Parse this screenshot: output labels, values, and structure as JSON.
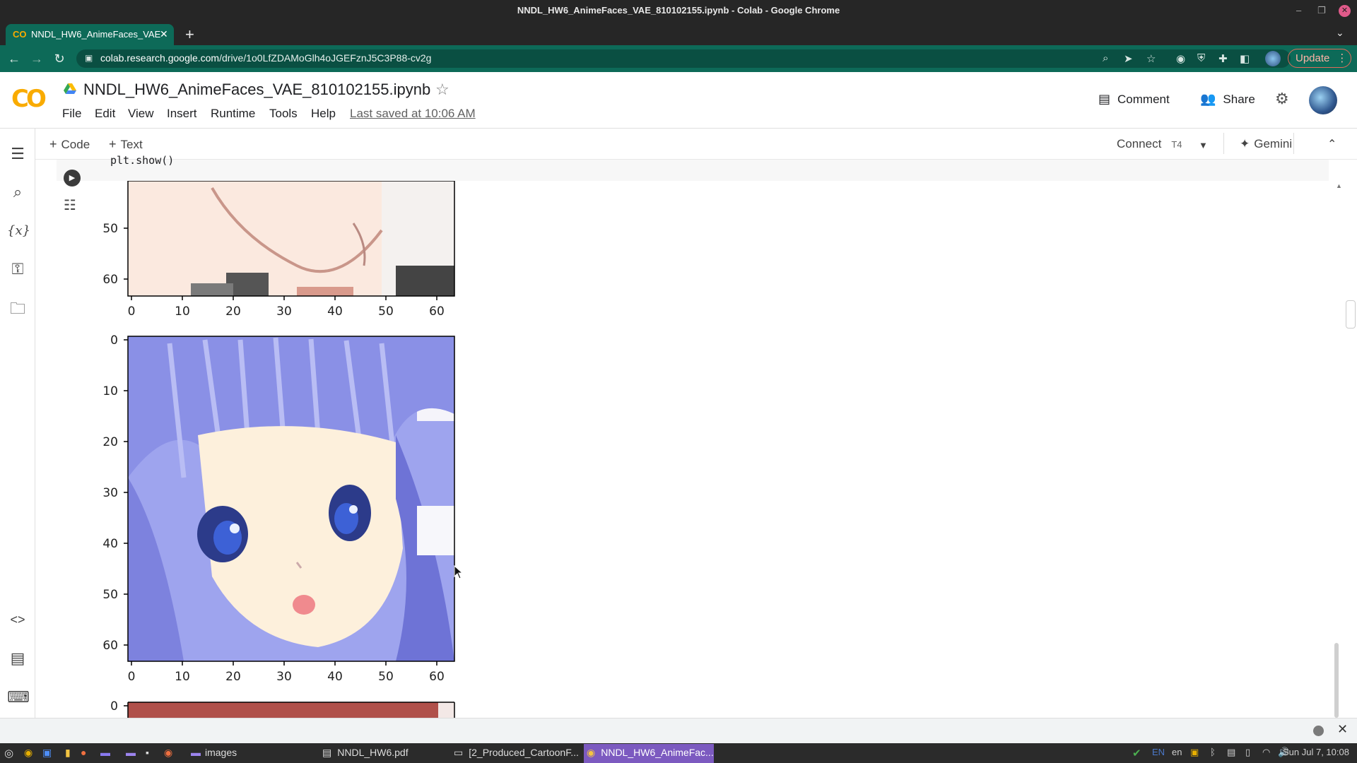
{
  "window": {
    "title": "NNDL_HW6_AnimeFaces_VAE_810102155.ipynb - Colab - Google Chrome"
  },
  "browser": {
    "tab_title": "NNDL_HW6_AnimeFaces_VAE",
    "url_host": "colab.research.google.com",
    "url_path": "/drive/1o0LfZDAMoGlh4oJGEFznJ5C3P88-cv2g",
    "update_label": "Update"
  },
  "notebook": {
    "title": "NNDL_HW6_AnimeFaces_VAE_810102155.ipynb",
    "menu": [
      "File",
      "Edit",
      "View",
      "Insert",
      "Runtime",
      "Tools",
      "Help"
    ],
    "last_saved": "Last saved at 10:06 AM",
    "comment_label": "Comment",
    "share_label": "Share"
  },
  "toolbar": {
    "add_code": "Code",
    "add_text": "Text",
    "connect": "Connect",
    "runtime": "T4",
    "gemini": "Gemini"
  },
  "cell": {
    "code_line": "plt.show()"
  },
  "plots": {
    "x_ticks": [
      "0",
      "10",
      "20",
      "30",
      "40",
      "50",
      "60"
    ],
    "y_ticks": [
      "0",
      "10",
      "20",
      "30",
      "40",
      "50",
      "60"
    ],
    "top_partial_y_ticks": [
      "50",
      "60"
    ],
    "bottom_partial_y_ticks": [
      "0"
    ]
  },
  "taskbar": {
    "items": [
      "images",
      "NNDL_HW6.pdf",
      "[2_Produced_CartoonF...",
      "NNDL_HW6_AnimeFac..."
    ],
    "lang": "EN",
    "lang2": "en",
    "clock": "Sun Jul 7, 10:08"
  }
}
